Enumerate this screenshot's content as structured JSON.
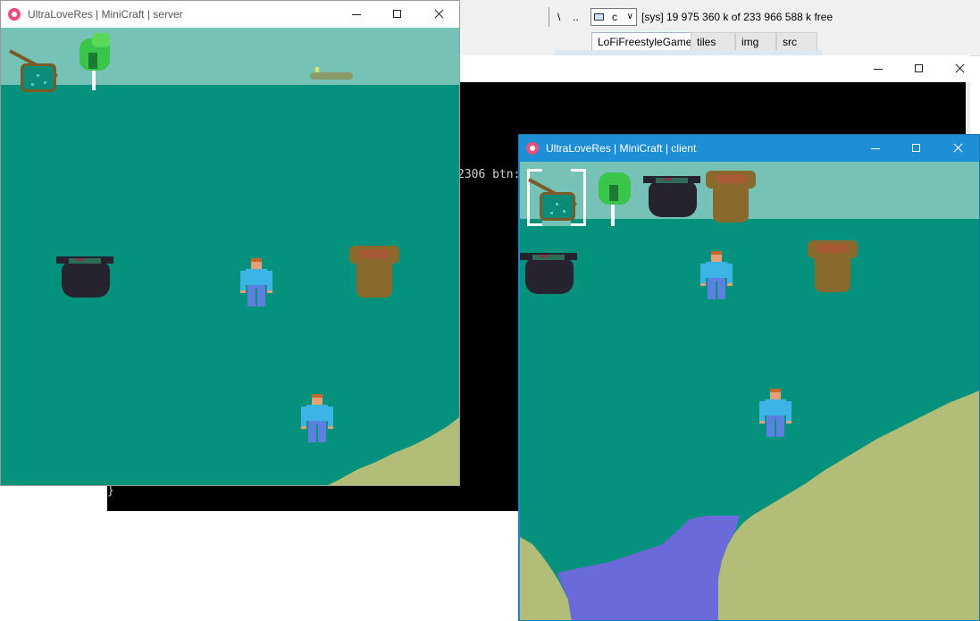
{
  "file_manager": {
    "nav_glyphs": [
      "\\",
      ".."
    ],
    "drive": "c",
    "disk_status": "[sys]  19 975 360 k of 233 966 588 k free",
    "tabs": [
      {
        "label": "LoFiFreestyleGame",
        "active": true
      },
      {
        "label": "tiles",
        "active": false
      },
      {
        "label": "img",
        "active": false
      },
      {
        "label": "src",
        "active": false
      }
    ]
  },
  "console": {
    "lines": [
      "2306 btn:",
      "}"
    ]
  },
  "server_window": {
    "title": "UltraLoveRes | MiniCraft | server"
  },
  "client_window": {
    "title": "UltraLoveRes | MiniCraft | client"
  },
  "colors": {
    "grass": "#05927c",
    "hud": "#76c2b6",
    "sand": "#b2bd78",
    "water": "#6a6ad8",
    "titlebar_active": "#1e8fd6"
  },
  "icons": [
    "app-heart-icon",
    "minimize-icon",
    "maximize-icon",
    "close-icon",
    "drive-icon",
    "chevron-down-icon"
  ]
}
